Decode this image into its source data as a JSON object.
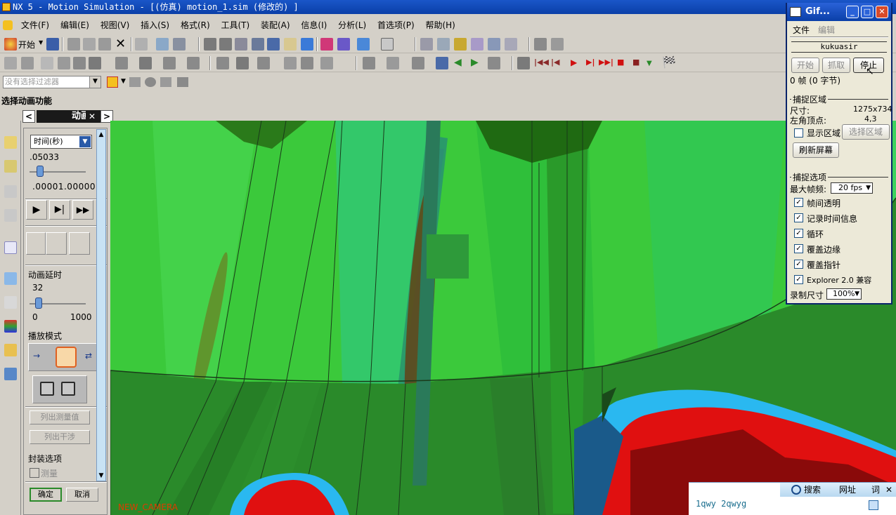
{
  "window": {
    "title": "NX 5 - Motion Simulation - [(仿真) motion_1.sim  (修改的) ]"
  },
  "menubar": {
    "items": [
      "文件(F)",
      "编辑(E)",
      "视图(V)",
      "插入(S)",
      "格式(R)",
      "工具(T)",
      "装配(A)",
      "信息(I)",
      "分析(L)",
      "首选项(P)",
      "帮助(H)"
    ]
  },
  "toolbar": {
    "start_label": "开始"
  },
  "filter": {
    "placeholder": "没有选择过滤器"
  },
  "cue": {
    "text": "选择动画功能"
  },
  "animation_panel": {
    "title": "动画",
    "time_select": "时间(秒)",
    "time_value": ".05033",
    "time_range": ".00001.00000",
    "delay_label": "动画延时",
    "delay_value": "32",
    "delay_min": "0",
    "delay_max": "1000",
    "play_mode_label": "播放模式",
    "list_measure_label": "列出测量值",
    "list_interference_label": "列出干涉",
    "package_options_label": "封装选项",
    "measure_label": "测量",
    "ok_label": "确定",
    "cancel_label": "取消"
  },
  "viewport": {
    "camera_label": "NEW_CAMERA"
  },
  "gif_recorder": {
    "title": "Gif...",
    "menu_file": "文件",
    "menu_edit": "编辑",
    "user_name": "kukuasir",
    "start_button": "开始",
    "capture_button": "抓取",
    "stop_button": "停止",
    "frame_info": "0 帧 (0 字节)",
    "capture_area_heading": "捕捉区域",
    "size_label": "尺寸:",
    "size_value": "1275x734",
    "corner_label": "左角顶点:",
    "corner_value": "4,3",
    "show_area_label": "显示区域",
    "select_area_button": "选择区域",
    "refresh_button": "刷新屏幕",
    "capture_options_heading": "捕捉选项",
    "max_fps_label": "最大帧频:",
    "max_fps_value": "20 fps",
    "options": [
      {
        "label": "帧间透明",
        "checked": true
      },
      {
        "label": "记录时间信息",
        "checked": true
      },
      {
        "label": "循环",
        "checked": true
      },
      {
        "label": "覆盖边缘",
        "checked": true
      },
      {
        "label": "覆盖指针",
        "checked": true
      },
      {
        "label": "Explorer 2.0 兼容",
        "checked": true
      }
    ],
    "record_size_label": "录制尺寸",
    "record_size_value": "100%"
  },
  "taskbar": {
    "search_label": "搜索",
    "url_label": "网址",
    "word_label": "词",
    "ime_text": "1qwy 2qwyg"
  }
}
